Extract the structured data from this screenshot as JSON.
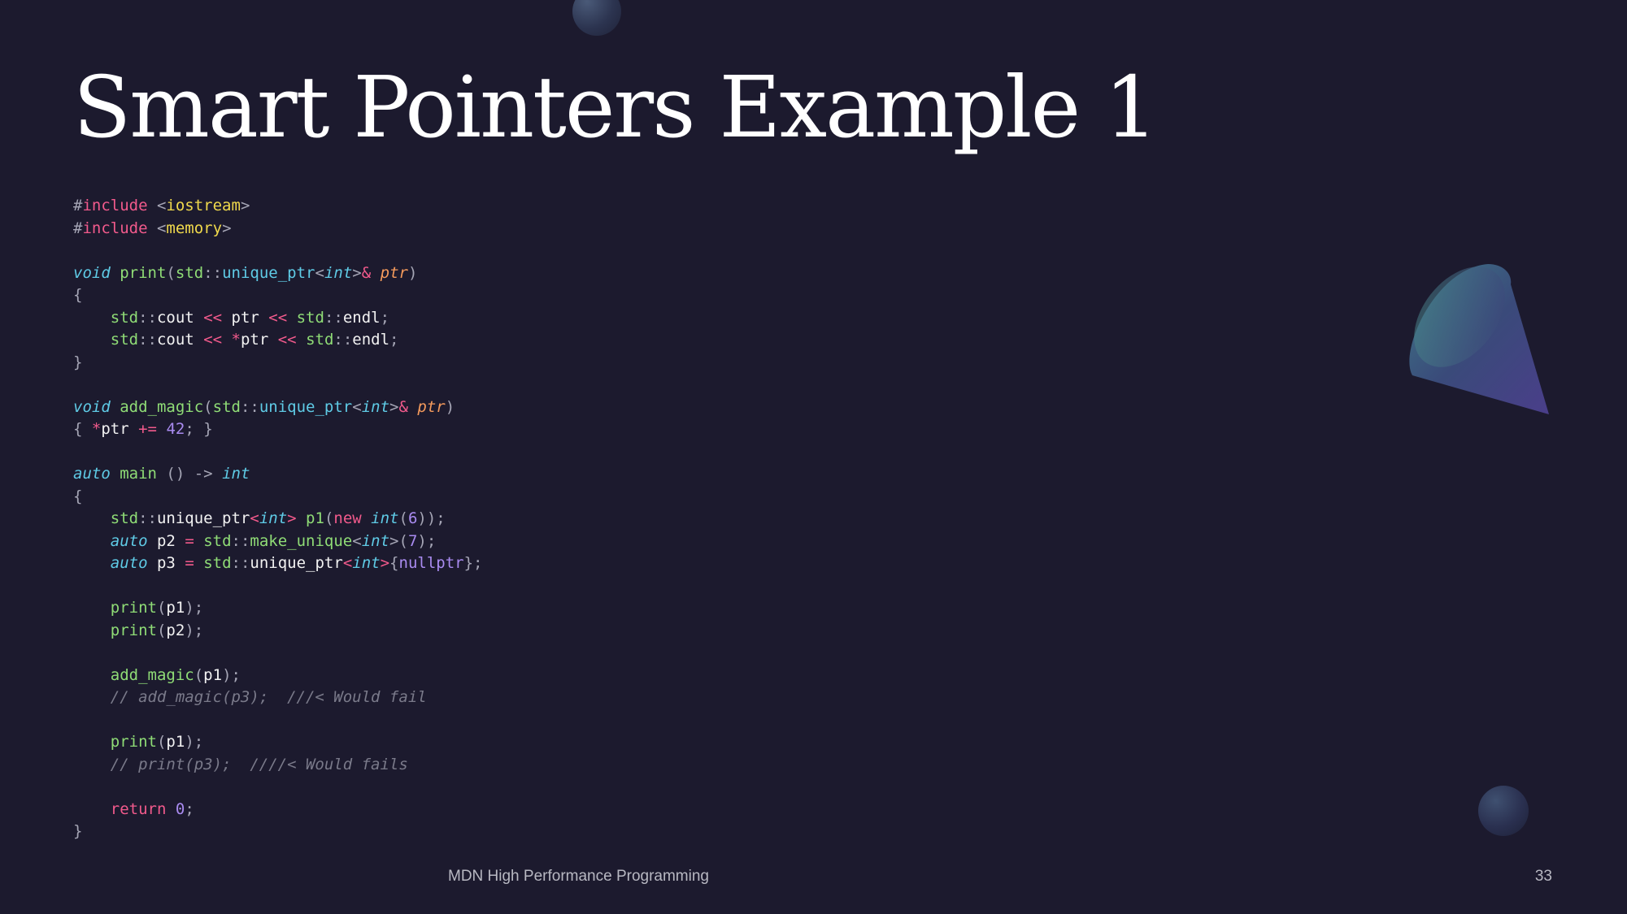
{
  "slide": {
    "title": "Smart Pointers Example 1",
    "footer": "MDN High Performance Programming",
    "page_number": "33"
  },
  "code": {
    "lines": [
      [
        [
          "#",
          "punc"
        ],
        [
          "include",
          "kw"
        ],
        [
          " <",
          "punc"
        ],
        [
          "iostream",
          "str"
        ],
        [
          ">",
          "punc"
        ]
      ],
      [
        [
          "#",
          "punc"
        ],
        [
          "include",
          "kw"
        ],
        [
          " <",
          "punc"
        ],
        [
          "memory",
          "str"
        ],
        [
          ">",
          "punc"
        ]
      ],
      [],
      [
        [
          "void",
          "type"
        ],
        [
          " ",
          "var"
        ],
        [
          "print",
          "fn"
        ],
        [
          "(",
          "punc"
        ],
        [
          "std",
          "ns"
        ],
        [
          "::",
          "punc"
        ],
        [
          "unique_ptr",
          "cls"
        ],
        [
          "<",
          "punc"
        ],
        [
          "int",
          "type"
        ],
        [
          ">",
          "punc"
        ],
        [
          "&",
          "op"
        ],
        [
          " ",
          "var"
        ],
        [
          "ptr",
          "param"
        ],
        [
          ")",
          "punc"
        ]
      ],
      [
        [
          "{",
          "punc"
        ]
      ],
      [
        [
          "    ",
          "var"
        ],
        [
          "std",
          "ns"
        ],
        [
          "::",
          "punc"
        ],
        [
          "cout",
          "var"
        ],
        [
          " << ",
          "op"
        ],
        [
          "ptr",
          "var"
        ],
        [
          " << ",
          "op"
        ],
        [
          "std",
          "ns"
        ],
        [
          "::",
          "punc"
        ],
        [
          "endl",
          "var"
        ],
        [
          ";",
          "punc"
        ]
      ],
      [
        [
          "    ",
          "var"
        ],
        [
          "std",
          "ns"
        ],
        [
          "::",
          "punc"
        ],
        [
          "cout",
          "var"
        ],
        [
          " << ",
          "op"
        ],
        [
          "*",
          "op"
        ],
        [
          "ptr",
          "var"
        ],
        [
          " << ",
          "op"
        ],
        [
          "std",
          "ns"
        ],
        [
          "::",
          "punc"
        ],
        [
          "endl",
          "var"
        ],
        [
          ";",
          "punc"
        ]
      ],
      [
        [
          "}",
          "punc"
        ]
      ],
      [],
      [
        [
          "void",
          "type"
        ],
        [
          " ",
          "var"
        ],
        [
          "add_magic",
          "fn"
        ],
        [
          "(",
          "punc"
        ],
        [
          "std",
          "ns"
        ],
        [
          "::",
          "punc"
        ],
        [
          "unique_ptr",
          "cls"
        ],
        [
          "<",
          "punc"
        ],
        [
          "int",
          "type"
        ],
        [
          ">",
          "punc"
        ],
        [
          "&",
          "op"
        ],
        [
          " ",
          "var"
        ],
        [
          "ptr",
          "param"
        ],
        [
          ")",
          "punc"
        ]
      ],
      [
        [
          "{ ",
          "punc"
        ],
        [
          "*",
          "op"
        ],
        [
          "ptr",
          "var"
        ],
        [
          " += ",
          "op"
        ],
        [
          "42",
          "num"
        ],
        [
          "; }",
          "punc"
        ]
      ],
      [],
      [
        [
          "auto",
          "type"
        ],
        [
          " ",
          "var"
        ],
        [
          "main",
          "fn"
        ],
        [
          " () -> ",
          "punc"
        ],
        [
          "int",
          "type"
        ]
      ],
      [
        [
          "{",
          "punc"
        ]
      ],
      [
        [
          "    ",
          "var"
        ],
        [
          "std",
          "ns"
        ],
        [
          "::",
          "punc"
        ],
        [
          "unique_ptr",
          "var"
        ],
        [
          "<",
          "op"
        ],
        [
          "int",
          "type"
        ],
        [
          "> ",
          "op"
        ],
        [
          "p1",
          "fn"
        ],
        [
          "(",
          "punc"
        ],
        [
          "new",
          "kw"
        ],
        [
          " ",
          "var"
        ],
        [
          "int",
          "type"
        ],
        [
          "(",
          "punc"
        ],
        [
          "6",
          "num"
        ],
        [
          "));",
          "punc"
        ]
      ],
      [
        [
          "    ",
          "var"
        ],
        [
          "auto",
          "type"
        ],
        [
          " ",
          "var"
        ],
        [
          "p2",
          "var"
        ],
        [
          " = ",
          "op"
        ],
        [
          "std",
          "ns"
        ],
        [
          "::",
          "punc"
        ],
        [
          "make_unique",
          "fn"
        ],
        [
          "<",
          "punc"
        ],
        [
          "int",
          "type"
        ],
        [
          ">",
          "punc"
        ],
        [
          "(",
          "punc"
        ],
        [
          "7",
          "num"
        ],
        [
          ");",
          "punc"
        ]
      ],
      [
        [
          "    ",
          "var"
        ],
        [
          "auto",
          "type"
        ],
        [
          " ",
          "var"
        ],
        [
          "p3",
          "var"
        ],
        [
          " = ",
          "op"
        ],
        [
          "std",
          "ns"
        ],
        [
          "::",
          "punc"
        ],
        [
          "unique_ptr",
          "var"
        ],
        [
          "<",
          "op"
        ],
        [
          "int",
          "type"
        ],
        [
          ">",
          "op"
        ],
        [
          "{",
          "punc"
        ],
        [
          "nullptr",
          "num"
        ],
        [
          "};",
          "punc"
        ]
      ],
      [],
      [
        [
          "    ",
          "var"
        ],
        [
          "print",
          "fn"
        ],
        [
          "(",
          "punc"
        ],
        [
          "p1",
          "var"
        ],
        [
          ");",
          "punc"
        ]
      ],
      [
        [
          "    ",
          "var"
        ],
        [
          "print",
          "fn"
        ],
        [
          "(",
          "punc"
        ],
        [
          "p2",
          "var"
        ],
        [
          ");",
          "punc"
        ]
      ],
      [],
      [
        [
          "    ",
          "var"
        ],
        [
          "add_magic",
          "fn"
        ],
        [
          "(",
          "punc"
        ],
        [
          "p1",
          "var"
        ],
        [
          ");",
          "punc"
        ]
      ],
      [
        [
          "    ",
          "var"
        ],
        [
          "// add_magic(p3);  ///< Would fail",
          "cmt"
        ]
      ],
      [],
      [
        [
          "    ",
          "var"
        ],
        [
          "print",
          "fn"
        ],
        [
          "(",
          "punc"
        ],
        [
          "p1",
          "var"
        ],
        [
          ");",
          "punc"
        ]
      ],
      [
        [
          "    ",
          "var"
        ],
        [
          "// print(p3);  ////< Would fails",
          "cmt"
        ]
      ],
      [],
      [
        [
          "    ",
          "var"
        ],
        [
          "return",
          "kw"
        ],
        [
          " ",
          "var"
        ],
        [
          "0",
          "num"
        ],
        [
          ";",
          "punc"
        ]
      ],
      [
        [
          "}",
          "punc"
        ]
      ]
    ]
  }
}
